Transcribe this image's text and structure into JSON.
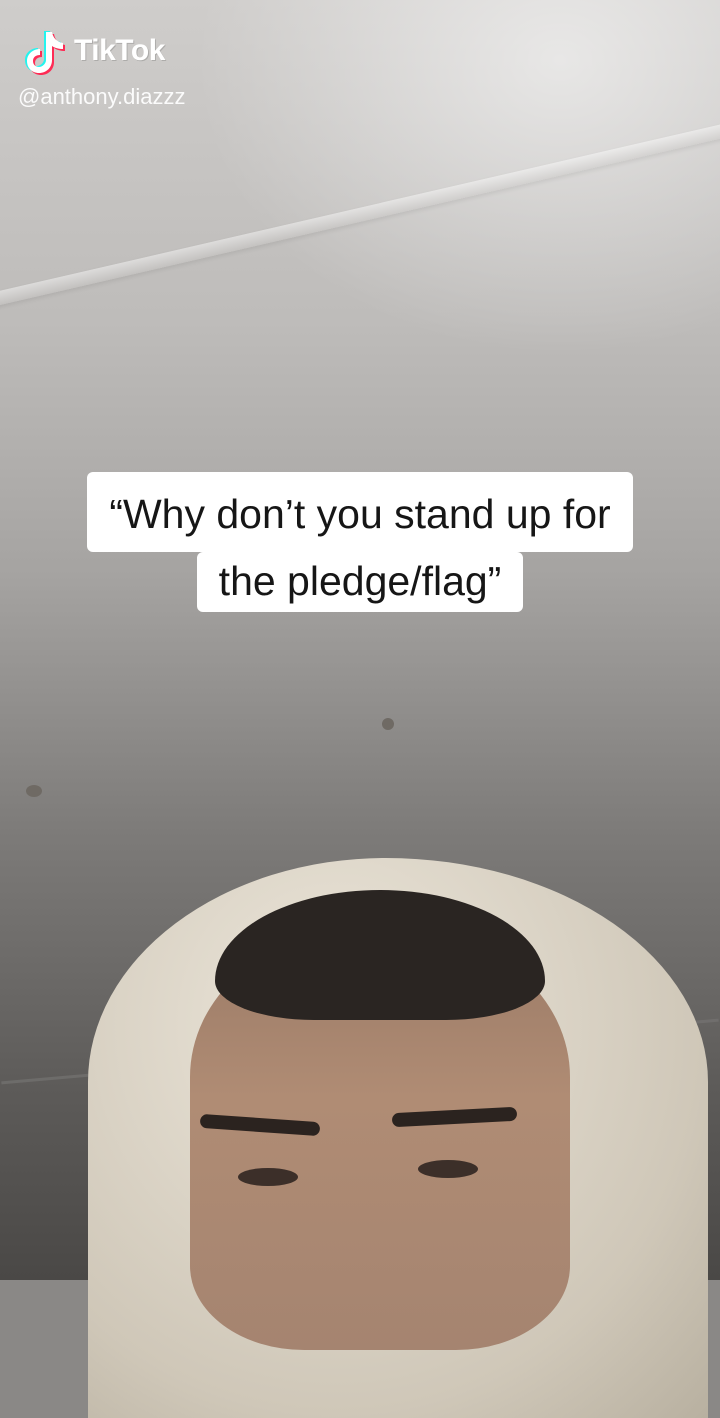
{
  "brand": {
    "name": "TikTok",
    "icon": "tiktok-note-icon",
    "handle": "@anthony.diazzz"
  },
  "caption": {
    "line1": "“Why don’t you stand up for",
    "line2": "the pledge/flag”"
  },
  "colors": {
    "caption_bg": "#ffffff",
    "caption_text": "#161616",
    "brand_cyan": "#25f4ee",
    "brand_red": "#fe2c55"
  }
}
